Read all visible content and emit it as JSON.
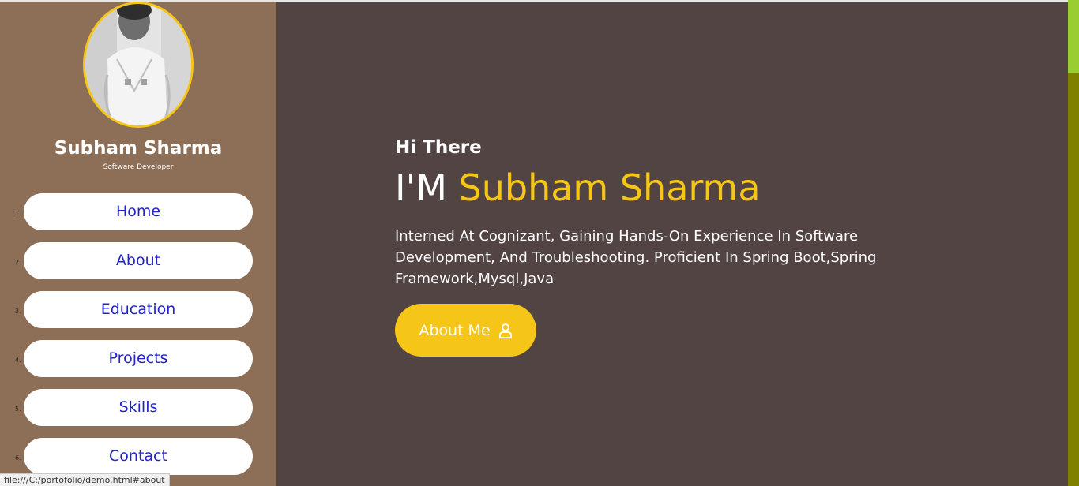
{
  "profile": {
    "name": "Subham Sharma",
    "role": "Software Developer"
  },
  "nav": {
    "items": [
      {
        "num": "1.",
        "label": "Home"
      },
      {
        "num": "2.",
        "label": "About"
      },
      {
        "num": "3.",
        "label": "Education"
      },
      {
        "num": "4.",
        "label": "Projects"
      },
      {
        "num": "5.",
        "label": "Skills"
      },
      {
        "num": "6.",
        "label": "Contact"
      }
    ]
  },
  "hero": {
    "greeting": "Hi There",
    "headline_prefix": "I'M ",
    "headline_name": "Subham Sharma",
    "bio": "Interned At Cognizant, Gaining Hands-On Experience In Software Development, And Troubleshooting. Proficient In Spring Boot,Spring Framework,Mysql,Java",
    "button_label": "About Me",
    "button_icon": "user-icon"
  },
  "status_bar": {
    "url": "file:///C:/portofolio/demo.html#about"
  },
  "colors": {
    "sidebar_bg": "#8d6e56",
    "main_bg": "#534444",
    "accent": "#f5c518",
    "nav_text": "#2222cc",
    "scroll_track": "#808000",
    "scroll_thumb": "#9acd32"
  }
}
